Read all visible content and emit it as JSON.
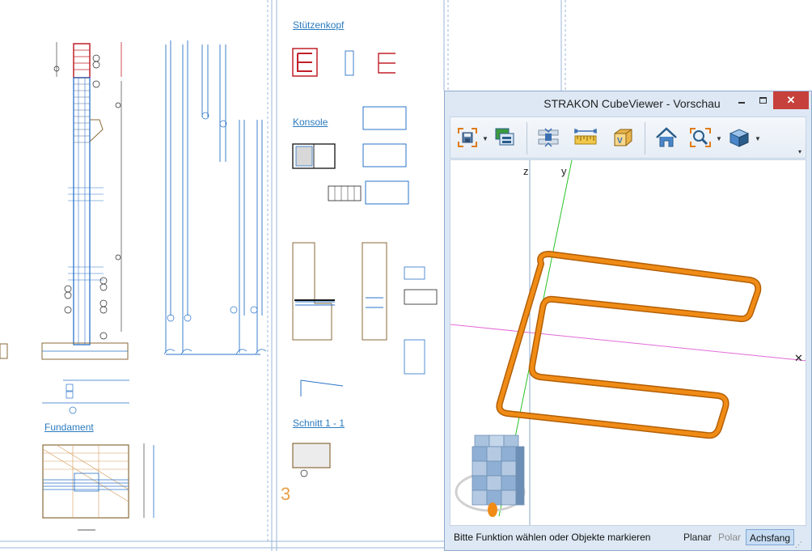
{
  "drawing": {
    "sheet_links": {
      "stuetzenkopf": "Stützenkopf",
      "konsole": "Konsole",
      "schnitt": "Schnitt 1 - 1",
      "fundament": "Fundament"
    },
    "sheet_marker": "3"
  },
  "viewer": {
    "title": "STRAKON CubeViewer - Vorschau",
    "window_buttons": {
      "minimize": "–",
      "maximize": "□",
      "close": "✕"
    },
    "toolbar": [
      {
        "id": "save",
        "icon": "save-icon",
        "has_dropdown": true
      },
      {
        "id": "layers",
        "icon": "layers-icon",
        "has_dropdown": false
      },
      {
        "id": "split",
        "icon": "split-view-icon",
        "has_dropdown": false
      },
      {
        "id": "measure",
        "icon": "measure-icon",
        "has_dropdown": false
      },
      {
        "id": "view-cube",
        "icon": "view-cube-icon",
        "has_dropdown": false
      },
      {
        "id": "home",
        "icon": "home-icon",
        "has_dropdown": false
      },
      {
        "id": "zoom",
        "icon": "zoom-icon",
        "has_dropdown": true
      },
      {
        "id": "shading",
        "icon": "shading-icon",
        "has_dropdown": true
      }
    ],
    "axes": {
      "z": "z",
      "y": "y",
      "x": "x"
    },
    "status": {
      "message": "Bitte Funktion wählen oder Objekte markieren",
      "modes": {
        "planar": "Planar",
        "polar": "Polar",
        "achsfang": "Achsfang"
      },
      "active_mode": "Achsfang"
    },
    "colors": {
      "rebar": "#f08c16",
      "rebar_edge": "#b35f06",
      "x_axis": "#e36ad8",
      "y_axis": "#27c227",
      "z_axis": "#8aa6c8",
      "accent": "#c7413c"
    }
  }
}
